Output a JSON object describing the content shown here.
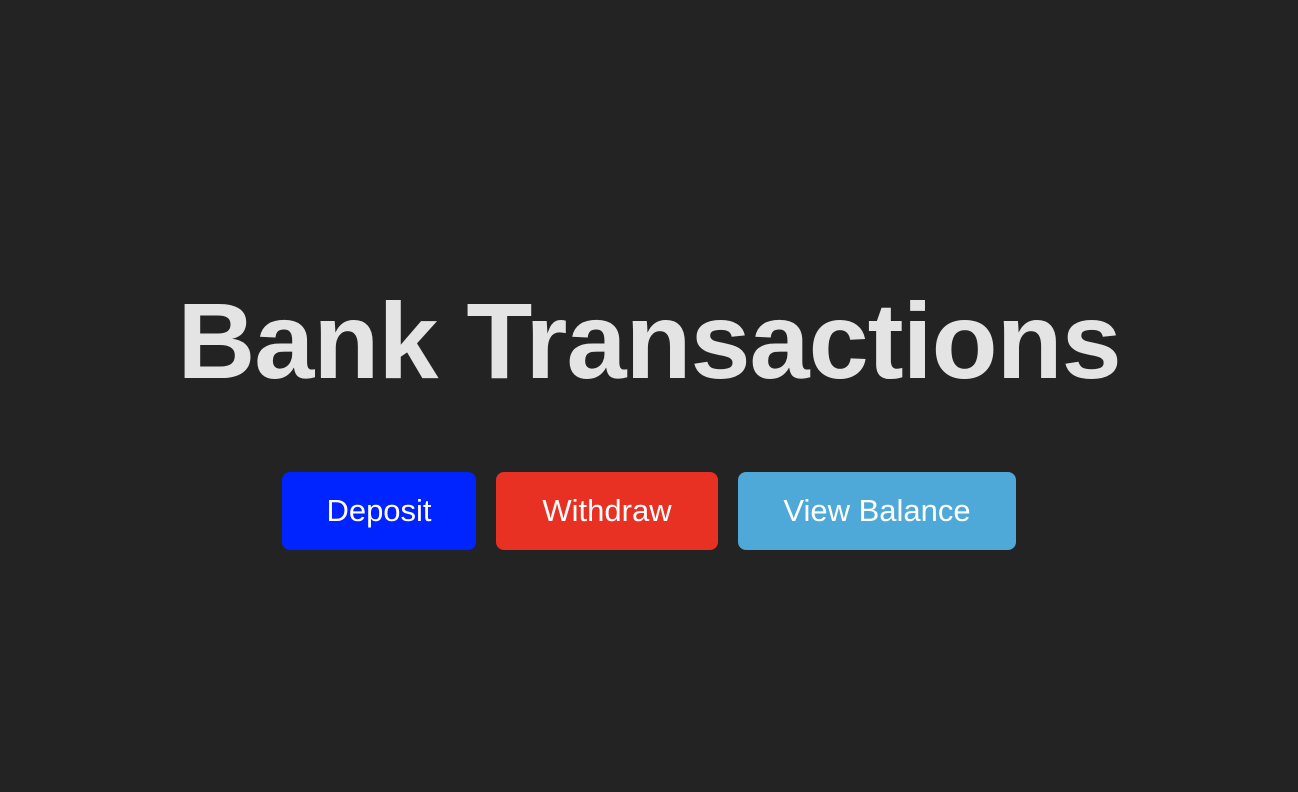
{
  "page": {
    "title": "Bank Transactions",
    "background_color": "#232323",
    "title_color": "#e4e4e4"
  },
  "actions": [
    {
      "label": "Deposit",
      "color": "#0024ff"
    },
    {
      "label": "Withdraw",
      "color": "#e93123"
    },
    {
      "label": "View Balance",
      "color": "#4ea8d8"
    }
  ]
}
